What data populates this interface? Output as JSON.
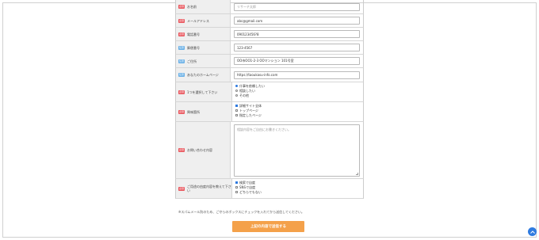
{
  "badges": {
    "required": "必須",
    "optional": "任意"
  },
  "fields": [
    {
      "label": "お名前",
      "badge": "required",
      "value": "リサーチ太郎",
      "placeholder": true
    },
    {
      "label": "メールアドレス",
      "badge": "required",
      "value": "abc@gmail.com",
      "placeholder": false
    },
    {
      "label": "電話番号",
      "badge": "required",
      "value": "090123456?8",
      "placeholder": false
    },
    {
      "label": "郵便番号",
      "badge": "optional",
      "value": "123-4567",
      "placeholder": false
    },
    {
      "label": "ご住所",
      "badge": "optional",
      "value": "OO市OO1-2-3 OOマンション 101号室",
      "placeholder": false
    },
    {
      "label": "あなたのホームページ",
      "badge": "optional",
      "value": "https://taoukasu-info.com",
      "placeholder": false
    }
  ],
  "choice_one": {
    "label": "1つを選択して下さい",
    "badge": "required",
    "options": [
      "什事を依頼したい",
      "相談したい",
      "その他"
    ],
    "selected": 0
  },
  "interest": {
    "label": "興味箇所",
    "badge": "required",
    "options": [
      "詳細サイト全体",
      "トップページ",
      "指定したページ"
    ],
    "checked": [
      0
    ]
  },
  "inquiry": {
    "label": "お問い合わせ内容",
    "badge": "required",
    "placeholder": "相談内容をご自由にお書きください。"
  },
  "knowledge": {
    "label": "ご用途の由度内容を教えて下さい",
    "badge": "required",
    "options": [
      "検索で自度",
      "SNSで自度",
      "どちらでもない"
    ],
    "checked": [
      0
    ]
  },
  "note": "※スパムメール防のため、ご守らのボックスにチェックを入れてから送信してください。",
  "submit_label": "上記の内容で送信する",
  "colors": {
    "required": "#e9585f",
    "optional": "#6ab0e6",
    "button": "#f4a14a",
    "accent": "#2f7be0"
  }
}
